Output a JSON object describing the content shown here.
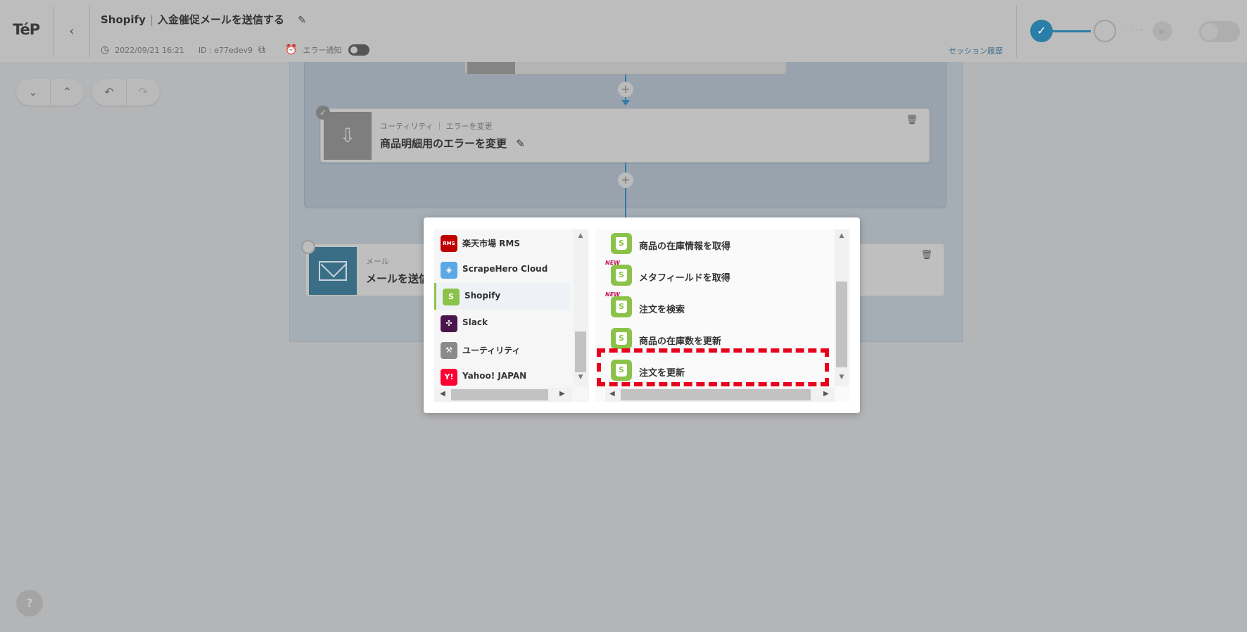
{
  "header": {
    "logo": "TéP",
    "back_icon": "‹",
    "flow_service": "Shopify",
    "flow_separator": "|",
    "flow_name": "入金催促メールを送信する",
    "edit_icon": "✎",
    "timestamp": "2022/09/21 16:21",
    "id_label": "ID : e77edev9",
    "error_notify_label": "エラー通知",
    "session_link": "セッション履歴"
  },
  "toolbar": {
    "collapse_icon": "⌄",
    "expand_icon": "⌃",
    "undo_icon": "↶",
    "redo_icon": "↷"
  },
  "canvas": {
    "plus_icon": "+",
    "check_icon": "✓",
    "delete_icon": "🗑",
    "card_change_error": {
      "subtitle": "ユーティリティ ｜ エラーを変更",
      "title": "商品明細用のエラーを変更",
      "edit_icon": "✎"
    },
    "card_mail": {
      "subtitle": "メール",
      "title": "メールを送信"
    }
  },
  "help_label": "?",
  "modal": {
    "services": [
      {
        "label": "楽天市場 RMS",
        "icon": "RMS",
        "color": "#bf0000"
      },
      {
        "label": "ScrapeHero Cloud",
        "icon": "◈",
        "color": "#5aa8e6"
      },
      {
        "label": "Shopify",
        "icon": "S",
        "color": "#8bc34a",
        "selected": true
      },
      {
        "label": "Slack",
        "icon": "✣",
        "color": "#4a154b"
      },
      {
        "label": "ユーティリティ",
        "icon": "⚒",
        "color": "#8a8a8a"
      },
      {
        "label": "Yahoo! JAPAN",
        "icon": "Y!",
        "color": "#ff0033"
      }
    ],
    "actions": [
      {
        "label": "商品の在庫情報を取得",
        "new": false
      },
      {
        "label": "メタフィールドを取得",
        "new": true
      },
      {
        "label": "注文を検索",
        "new": true
      },
      {
        "label": "商品の在庫数を更新",
        "new": false
      },
      {
        "label": "注文を更新",
        "new": false,
        "highlighted": true
      }
    ],
    "new_badge": "NEW",
    "highlight_color": "#e8001c",
    "accent_color": "#8bc34a"
  },
  "colors": {
    "step_active": "#2a7ea8",
    "connector": "#2f7ca4"
  }
}
